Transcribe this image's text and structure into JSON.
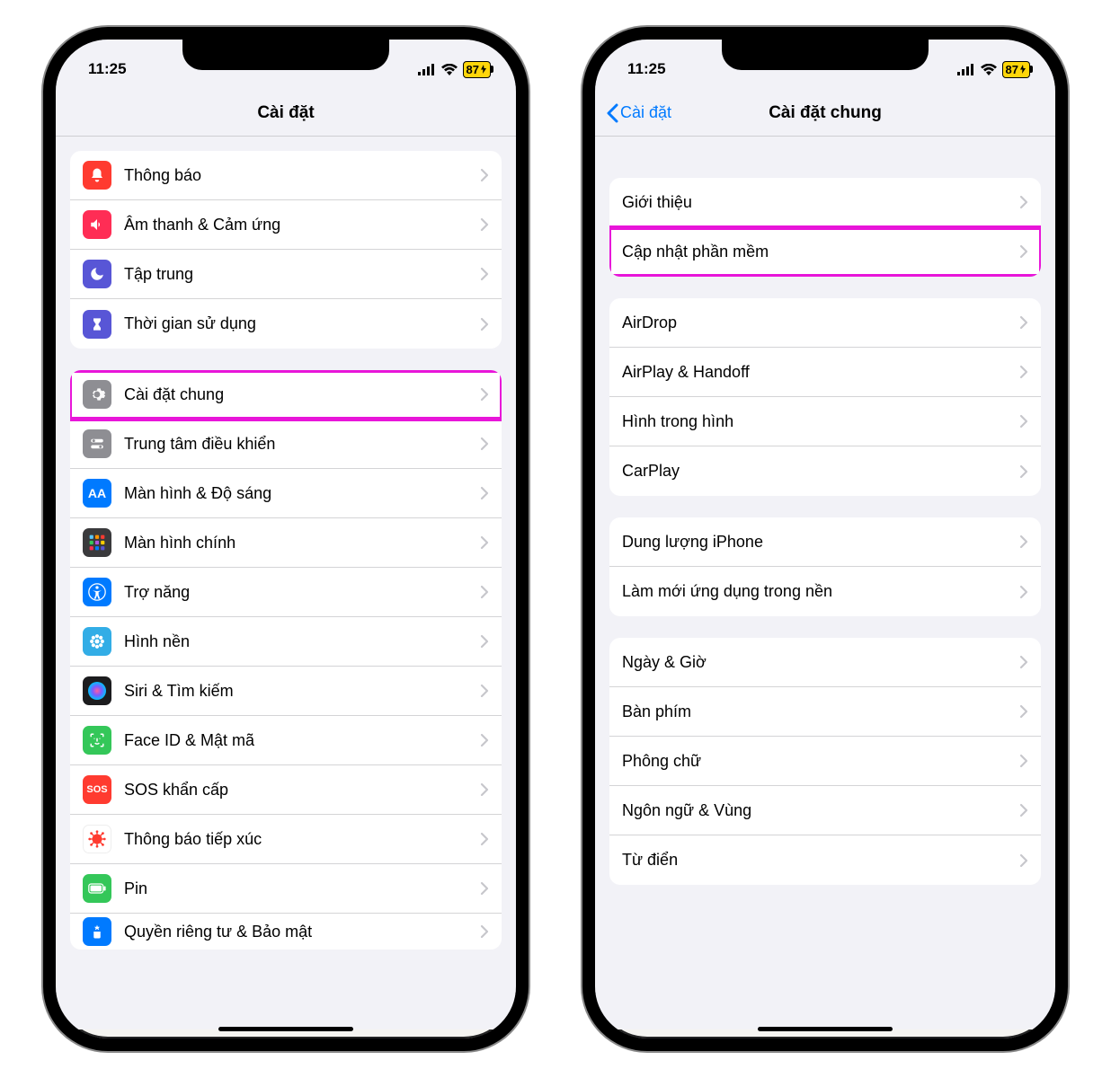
{
  "statusbar": {
    "time": "11:25",
    "battery": "87"
  },
  "highlight_color": "#e815d9",
  "phone1": {
    "nav_title": "Cài đặt",
    "section1": [
      {
        "icon": "bell-icon",
        "bg": "ic-red",
        "label": "Thông báo"
      },
      {
        "icon": "speaker-icon",
        "bg": "ic-pink",
        "label": "Âm thanh & Cảm ứng"
      },
      {
        "icon": "moon-icon",
        "bg": "ic-indigo",
        "label": "Tập trung"
      },
      {
        "icon": "hourglass-icon",
        "bg": "ic-indigo",
        "label": "Thời gian sử dụng"
      }
    ],
    "section2": [
      {
        "icon": "gear-icon",
        "bg": "ic-gray",
        "label": "Cài đặt chung",
        "highlight": true
      },
      {
        "icon": "switches-icon",
        "bg": "ic-gray",
        "label": "Trung tâm điều khiển"
      },
      {
        "icon": "aa-icon",
        "bg": "ic-blue",
        "label": "Màn hình & Độ sáng"
      },
      {
        "icon": "grid-icon",
        "bg": "ic-home",
        "label": "Màn hình chính"
      },
      {
        "icon": "accessibility-icon",
        "bg": "ic-blue",
        "label": "Trợ năng"
      },
      {
        "icon": "flower-icon",
        "bg": "ic-cyan",
        "label": "Hình nền"
      },
      {
        "icon": "siri-icon",
        "bg": "ic-siri",
        "label": "Siri & Tìm kiếm"
      },
      {
        "icon": "faceid-icon",
        "bg": "ic-green",
        "label": "Face ID & Mật mã"
      },
      {
        "icon": "sos-icon",
        "bg": "ic-sos",
        "label": "SOS khẩn cấp"
      },
      {
        "icon": "virus-icon",
        "bg": "ic-exp",
        "label": "Thông báo tiếp xúc"
      },
      {
        "icon": "battery-icon",
        "bg": "ic-batt",
        "label": "Pin"
      },
      {
        "icon": "hand-icon",
        "bg": "ic-priv",
        "label": "Quyền riêng tư & Bảo mật",
        "partial": true
      }
    ]
  },
  "phone2": {
    "nav_back": "Cài đặt",
    "nav_title": "Cài đặt chung",
    "section1": [
      {
        "label": "Giới thiệu"
      },
      {
        "label": "Cập nhật phần mềm",
        "highlight": true
      }
    ],
    "section2": [
      {
        "label": "AirDrop"
      },
      {
        "label": "AirPlay & Handoff"
      },
      {
        "label": "Hình trong hình"
      },
      {
        "label": "CarPlay"
      }
    ],
    "section3": [
      {
        "label": "Dung lượng iPhone"
      },
      {
        "label": "Làm mới ứng dụng trong nền"
      }
    ],
    "section4": [
      {
        "label": "Ngày & Giờ"
      },
      {
        "label": "Bàn phím"
      },
      {
        "label": "Phông chữ"
      },
      {
        "label": "Ngôn ngữ & Vùng"
      },
      {
        "label": "Từ điển"
      }
    ]
  }
}
